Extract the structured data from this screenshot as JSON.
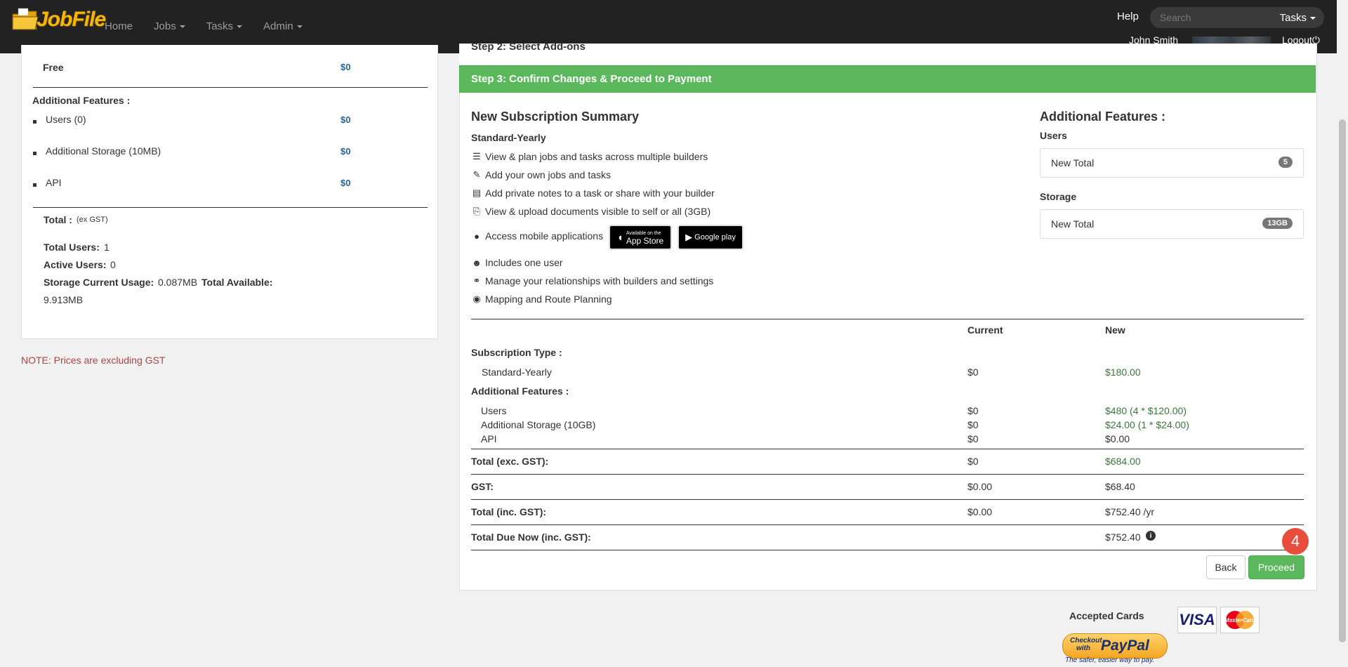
{
  "nav": {
    "brand": "JobFile",
    "links": [
      {
        "label": "Home",
        "has_caret": false
      },
      {
        "label": "Jobs",
        "has_caret": true
      },
      {
        "label": "Tasks",
        "has_caret": true
      },
      {
        "label": "Admin",
        "has_caret": true
      }
    ],
    "help": "Help",
    "search_placeholder": "Search",
    "search_scope": "Tasks",
    "user_name": "John Smith",
    "logout": "Logout"
  },
  "left": {
    "plan_row": {
      "label": "Free",
      "price": "$0"
    },
    "additional_title": "Additional Features :",
    "features": [
      {
        "label": "Users (0)",
        "price": "$0"
      },
      {
        "label": "Additional Storage (10MB)",
        "price": "$0"
      },
      {
        "label": "API",
        "price": "$0"
      }
    ],
    "total_label": "Total :",
    "total_note": "(ex GST)",
    "total_users_label": "Total Users:",
    "total_users_value": "1",
    "active_users_label": "Active Users:",
    "active_users_value": "0",
    "storage_label": "Storage Current Usage:",
    "storage_value": "0.087MB",
    "total_available_label": "Total Available:",
    "total_available_value": "9.913MB",
    "note": "NOTE: Prices are excluding GST"
  },
  "step2_title": "Step 2: Select Add-ons",
  "step3_title": "Step 3: Confirm Changes & Proceed to Payment",
  "summary": {
    "title": "New Subscription Summary",
    "plan": "Standard-Yearly",
    "features": [
      {
        "icon": "server-icon",
        "text": "View & plan jobs and tasks across multiple builders"
      },
      {
        "icon": "edit-icon",
        "text": "Add your own jobs and tasks"
      },
      {
        "icon": "notes-icon",
        "text": "Add private notes to a task or share with your builder"
      },
      {
        "icon": "paperclip-icon",
        "text": "View & upload documents visible to self or all (3GB)"
      },
      {
        "icon": "globe-icon",
        "text": "Access mobile applications"
      },
      {
        "icon": "user-icon",
        "text": "Includes one user"
      },
      {
        "icon": "link-icon",
        "text": "Manage your relationships with builders and settings"
      },
      {
        "icon": "map-marker-icon",
        "text": "Mapping and Route Planning"
      }
    ],
    "app_store": {
      "small": "Available on the",
      "big": "App Store"
    },
    "google_play": {
      "label": "Google play"
    }
  },
  "additional": {
    "title": "Additional Features :",
    "users_heading": "Users",
    "users_box_label": "New Total",
    "users_badge": "5",
    "storage_heading": "Storage",
    "storage_box_label": "New Total",
    "storage_badge": "13GB"
  },
  "table": {
    "col_current": "Current",
    "col_new": "New",
    "sub_type_label": "Subscription Type :",
    "sub_type_name": "Standard-Yearly",
    "sub_type_current": "$0",
    "sub_type_new": "$180.00",
    "addl_label": "Additional Features :",
    "rows": [
      {
        "name": "Users",
        "current": "$0",
        "new": "$480 (4 * $120.00)"
      },
      {
        "name": "Additional Storage (10GB)",
        "current": "$0",
        "new": "$24.00 (1 * $24.00)"
      },
      {
        "name": "API",
        "current": "$0",
        "new": "$0.00"
      }
    ],
    "total_exc_label": "Total (exc. GST):",
    "total_exc_current": "$0",
    "total_exc_new": "$684.00",
    "gst_label": "GST:",
    "gst_current": "$0.00",
    "gst_new": "$68.40",
    "total_inc_label": "Total (inc. GST):",
    "total_inc_current": "$0.00",
    "total_inc_new": "$752.40 /yr",
    "due_label": "Total Due Now (inc. GST):",
    "due_new": "$752.40"
  },
  "buttons": {
    "back": "Back",
    "proceed": "Proceed"
  },
  "step_marker": "4",
  "payment": {
    "accepted_label": "Accepted Cards",
    "visa": "VISA",
    "mastercard": "MasterCard",
    "paypal_checkout": "Checkout with",
    "paypal_brand": "PayPal",
    "paypal_tagline": "The safer, easier way to pay."
  },
  "colors": {
    "navbar": "#222222",
    "step3": "#5cb85c",
    "green_text": "#3c763d",
    "price_blue": "#2a6496",
    "note_red": "#a94442",
    "marker": "#e74c3c"
  }
}
